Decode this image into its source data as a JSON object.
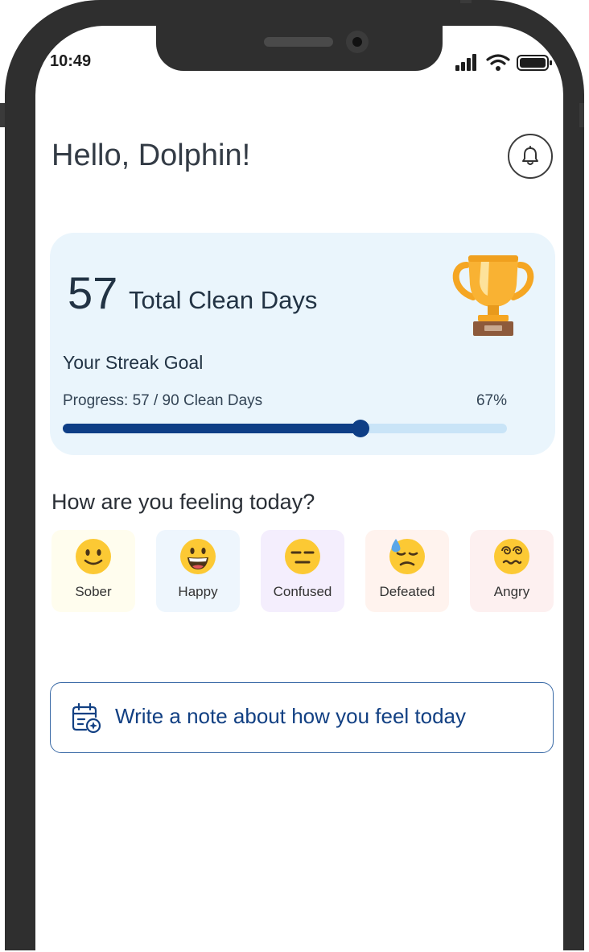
{
  "status_bar": {
    "time": "10:49"
  },
  "header": {
    "greeting": "Hello, Dolphin!"
  },
  "streak_card": {
    "total_clean_days": "57",
    "total_clean_days_label": "Total Clean Days",
    "goal_title": "Your Streak Goal",
    "progress_text": "Progress: 57 / 90 Clean Days",
    "progress_percent_text": "67%",
    "progress_fraction": 0.67
  },
  "mood": {
    "title": "How are you feeling today?",
    "options": [
      {
        "label": "Sober",
        "icon": "slightly-smiling-face-icon",
        "bg": "#fffdee"
      },
      {
        "label": "Happy",
        "icon": "grinning-face-icon",
        "bg": "#eef6fd"
      },
      {
        "label": "Confused",
        "icon": "expressionless-face-icon",
        "bg": "#f4eefd"
      },
      {
        "label": "Defeated",
        "icon": "downcast-sweat-face-icon",
        "bg": "#fff3ee"
      },
      {
        "label": "Angry",
        "icon": "dizzy-face-icon",
        "bg": "#fdf0f0"
      }
    ]
  },
  "note": {
    "label": "Write a note about how you feel today"
  },
  "colors": {
    "accent": "#0e3e86",
    "card_bg": "#eaf5fc",
    "progress_track": "#c9e4f7"
  }
}
